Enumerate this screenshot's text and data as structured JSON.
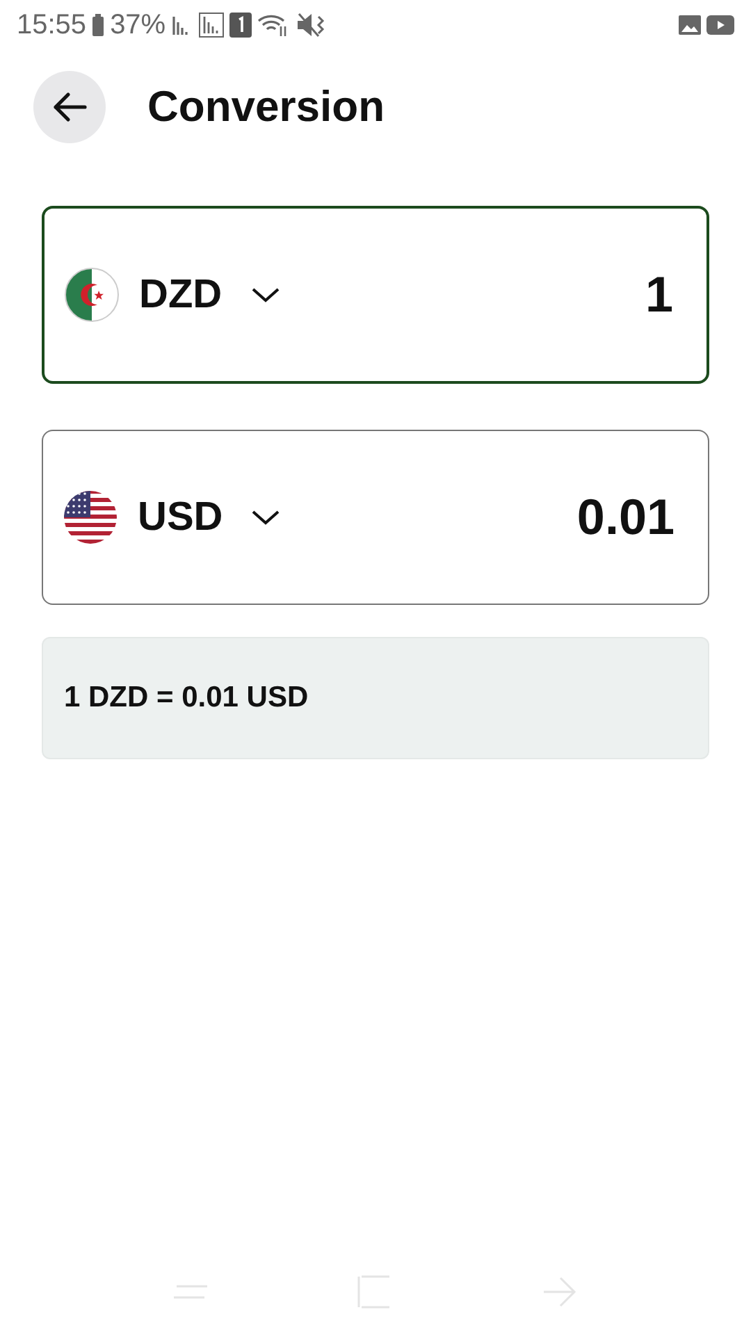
{
  "status_bar": {
    "time": "15:55",
    "battery": "37%"
  },
  "header": {
    "title": "Conversion"
  },
  "currencies": [
    {
      "code": "DZD",
      "kind": "algeria",
      "amount": "1",
      "focused": true
    },
    {
      "code": "USD",
      "kind": "usa",
      "amount": "0.01",
      "focused": false
    }
  ],
  "rate": {
    "text": "1 DZD = 0.01 USD"
  }
}
